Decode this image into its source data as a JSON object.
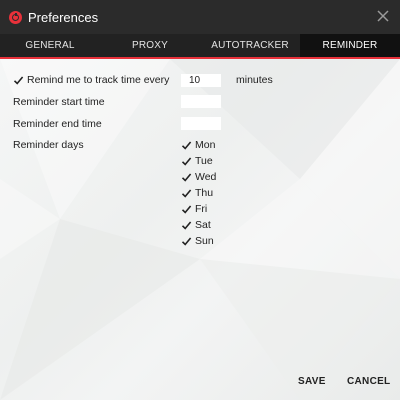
{
  "window": {
    "title": "Preferences"
  },
  "icons": {
    "app": "timer-icon",
    "close": "close-icon",
    "check": "checkmark-icon"
  },
  "colors": {
    "accent": "#e8313a",
    "titlebar": "#2b2b2b",
    "tabbar": "#222222",
    "active_tab": "#111111"
  },
  "tabs": [
    {
      "label": "GENERAL",
      "active": false
    },
    {
      "label": "PROXY",
      "active": false
    },
    {
      "label": "AUTOTRACKER",
      "active": false
    },
    {
      "label": "REMINDER",
      "active": true
    }
  ],
  "reminder": {
    "remind_label": "Remind me to track time every",
    "remind_checked": true,
    "interval_value": "10",
    "interval_unit": "minutes",
    "start_time_label": "Reminder start time",
    "start_time_value": "",
    "end_time_label": "Reminder end time",
    "end_time_value": "",
    "days_label": "Reminder days",
    "days": [
      {
        "label": "Mon",
        "checked": true
      },
      {
        "label": "Tue",
        "checked": true
      },
      {
        "label": "Wed",
        "checked": true
      },
      {
        "label": "Thu",
        "checked": true
      },
      {
        "label": "Fri",
        "checked": true
      },
      {
        "label": "Sat",
        "checked": true
      },
      {
        "label": "Sun",
        "checked": true
      }
    ]
  },
  "footer": {
    "save_label": "SAVE",
    "cancel_label": "CANCEL"
  }
}
